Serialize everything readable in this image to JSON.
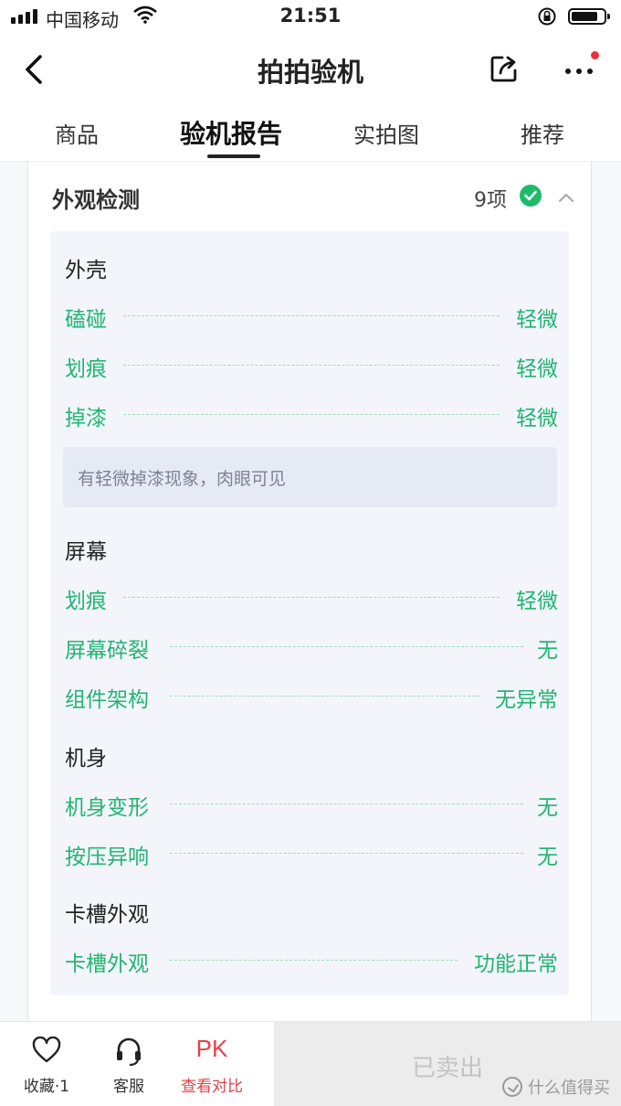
{
  "status_bar": {
    "carrier": "中国移动",
    "time": "21:51"
  },
  "header": {
    "title": "拍拍验机"
  },
  "tabs": [
    {
      "label": "商品",
      "active": false
    },
    {
      "label": "验机报告",
      "active": true
    },
    {
      "label": "实拍图",
      "active": false
    },
    {
      "label": "推荐",
      "active": false
    }
  ],
  "section": {
    "title": "外观检测",
    "count": "9项",
    "groups": [
      {
        "title": "外壳",
        "rows": [
          {
            "label": "磕碰",
            "value": "轻微"
          },
          {
            "label": "划痕",
            "value": "轻微"
          },
          {
            "label": "掉漆",
            "value": "轻微"
          }
        ],
        "note": "有轻微掉漆现象，肉眼可见"
      },
      {
        "title": "屏幕",
        "rows": [
          {
            "label": "划痕",
            "value": "轻微"
          },
          {
            "label": "屏幕碎裂",
            "value": "无"
          },
          {
            "label": "组件架构",
            "value": "无异常"
          }
        ]
      },
      {
        "title": "机身",
        "rows": [
          {
            "label": "机身变形",
            "value": "无"
          },
          {
            "label": "按压异响",
            "value": "无"
          }
        ]
      },
      {
        "title": "卡槽外观",
        "rows": [
          {
            "label": "卡槽外观",
            "value": "功能正常"
          }
        ]
      }
    ]
  },
  "bottom_bar": {
    "favorite_label": "收藏·1",
    "service_label": "客服",
    "pk_text": "PK",
    "compare_label": "查看对比",
    "sold_label": "已卖出"
  },
  "watermark": "什么值得买",
  "colors": {
    "accent_green": "#22b572",
    "pk_red": "#e8414a"
  }
}
